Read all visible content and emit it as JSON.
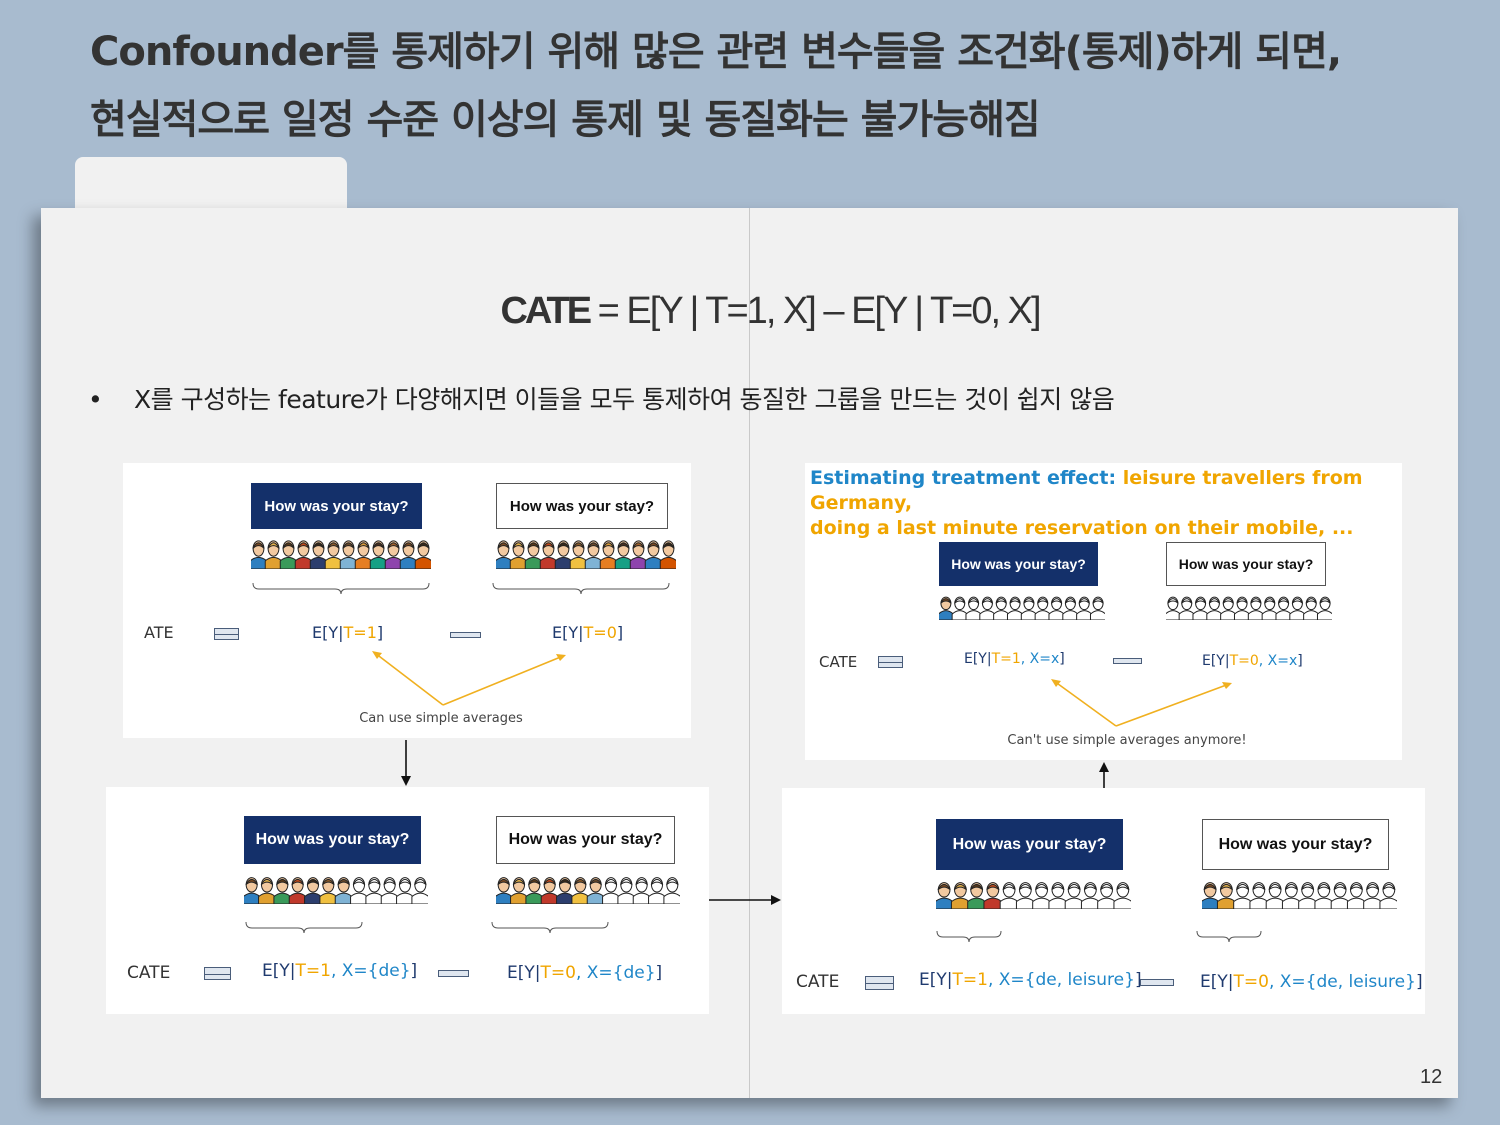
{
  "title": {
    "line1": "Confounder를 통제하기 위해 많은 관련 변수들을 조건화(통제)하게 되면,",
    "line2": "현실적으로 일정 수준 이상의 통제 및 동질화는 불가능해짐"
  },
  "formula": {
    "lhs": "CATE",
    "rhs": "= E[Y | T=1, X] – E[Y | T=0, X]"
  },
  "bullet": "X를 구성하는 feature가 다양해지면 이들을 모두 통제하여 동질한 그룹을 만드는 것이 쉽지 않음",
  "survey_question": "How was your stay?",
  "panels": {
    "ate": {
      "label": "ATE",
      "left_expr": {
        "pre": "E[Y|",
        "t": "T=1",
        "x": "",
        "post": "]"
      },
      "right_expr": {
        "pre": "E[Y|",
        "t": "T=0",
        "x": "",
        "post": "]"
      },
      "note": "Can use simple averages"
    },
    "cate_de": {
      "label": "CATE",
      "left_expr": {
        "pre": "E[Y|",
        "t": "T=1",
        "x": ", X={de}",
        "post": "]"
      },
      "right_expr": {
        "pre": "E[Y|",
        "t": "T=0",
        "x": ", X={de}",
        "post": "]"
      }
    },
    "cate_de_leisure": {
      "label": "CATE",
      "left_expr": {
        "pre": "E[Y|",
        "t": "T=1",
        "x": ", X={de, leisure}",
        "post": "]"
      },
      "right_expr": {
        "pre": "E[Y|",
        "t": "T=0",
        "x": ", X={de, leisure}",
        "post": "]"
      }
    },
    "cate_x": {
      "heading_blue": "Estimating treatment effect:",
      "heading_orange_1": " leisure travellers from Germany,",
      "heading_orange_2": "doing a last minute reservation on their mobile, ...",
      "label": "CATE",
      "left_expr": {
        "pre": "E[Y|",
        "t": "T=1",
        "x": ", X=x",
        "post": "]"
      },
      "right_expr": {
        "pre": "E[Y|",
        "t": "T=0",
        "x": ", X=x",
        "post": "]"
      },
      "note": "Can't use simple averages anymore!"
    }
  },
  "page_number": "12",
  "colors": {
    "background": "#a8bbcf",
    "navy": "#14306a",
    "orange": "#f0a500",
    "blue": "#1f86c8"
  }
}
